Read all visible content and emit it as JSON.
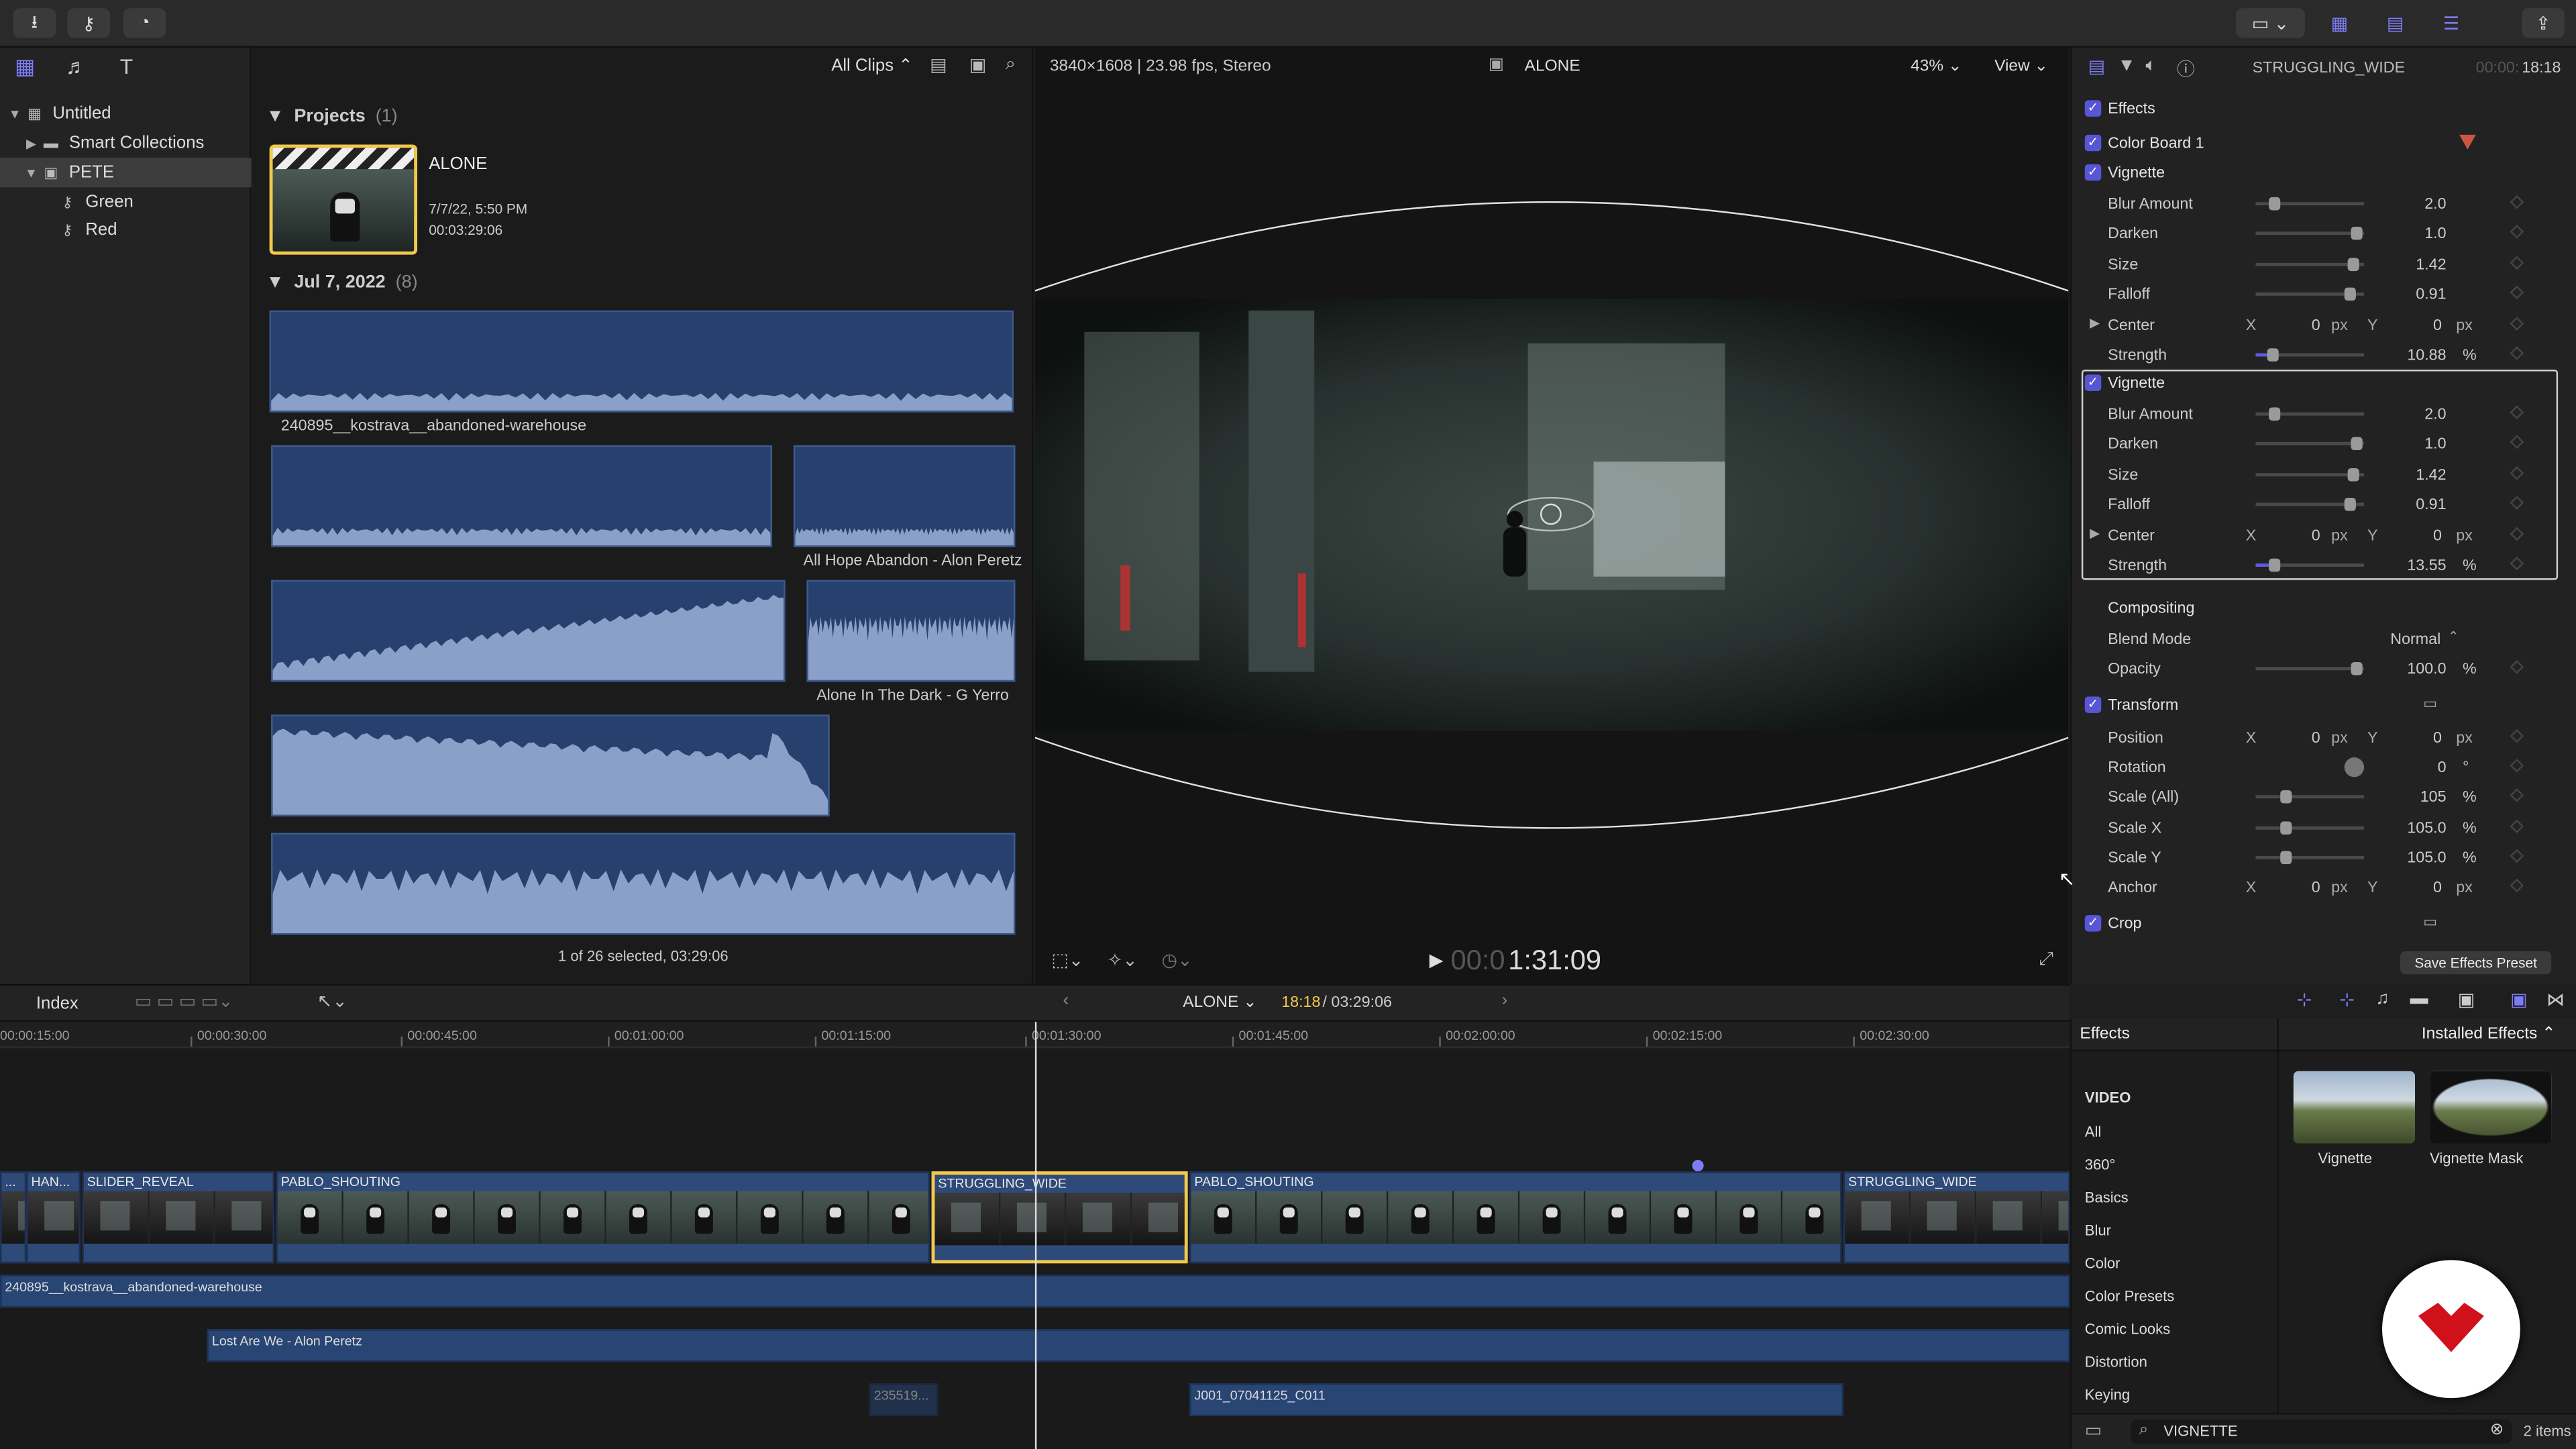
{
  "toolbar": {
    "icons": [
      "import-icon",
      "keyword-icon",
      "background-tasks-icon"
    ],
    "right_icons": [
      "workspace-icon",
      "layout-browser-icon",
      "layout-timeline-icon",
      "layout-inspector-icon",
      "share-icon"
    ]
  },
  "library": {
    "items": [
      {
        "label": "Untitled",
        "level": 0,
        "icon": "library-icon",
        "disclosure": "▼"
      },
      {
        "label": "Smart Collections",
        "level": 1,
        "icon": "folder-icon",
        "disclosure": "▶"
      },
      {
        "label": "PETE",
        "level": 1,
        "icon": "event-icon",
        "disclosure": "▼"
      },
      {
        "label": "Green",
        "level": 2,
        "icon": "keyword-icon",
        "disclosure": ""
      },
      {
        "label": "Red",
        "level": 2,
        "icon": "keyword-icon",
        "disclosure": ""
      }
    ]
  },
  "browser": {
    "filter": "All Clips",
    "status": "1 of 26 selected, 03:29:06",
    "projects_header": "Projects",
    "projects_count": "(1)",
    "project": {
      "name": "ALONE",
      "date": "7/7/22, 5:50 PM",
      "duration": "00:03:29:06"
    },
    "date_header": "Jul 7, 2022",
    "date_count": "(8)",
    "clips": [
      {
        "label": "240895__kostrava__abandoned-warehouse"
      },
      {
        "label": ""
      },
      {
        "label": "All Hope Abandon - Alon Peretz"
      },
      {
        "label": ""
      },
      {
        "label": "Alone In The Dark - G Yerro"
      },
      {
        "label": ""
      },
      {
        "label": ""
      }
    ]
  },
  "viewer": {
    "format": "3840×1608 | 23.98 fps, Stereo",
    "title": "ALONE",
    "zoom": "43%",
    "view_label": "View",
    "timecode_dim": "00:0",
    "timecode": "1:31:09"
  },
  "inspector": {
    "clip_name": "STRUGGLING_WIDE",
    "duration_dim": "00:00:",
    "duration": "18:18",
    "effects_label": "Effects",
    "color_board": "Color Board 1",
    "vignette1": {
      "title": "Vignette",
      "rows": [
        {
          "label": "Blur Amount",
          "value": "2.0",
          "pos": 0.17
        },
        {
          "label": "Darken",
          "value": "1.0",
          "pos": 0.93
        },
        {
          "label": "Size",
          "value": "1.42",
          "pos": 0.9
        },
        {
          "label": "Falloff",
          "value": "0.91",
          "pos": 0.86
        }
      ],
      "center": {
        "label": "Center",
        "x": "0",
        "y": "0",
        "unit": "px"
      },
      "strength": {
        "label": "Strength",
        "value": "10.88",
        "unit": "%",
        "pos": 0.15
      }
    },
    "vignette2": {
      "title": "Vignette",
      "rows": [
        {
          "label": "Blur Amount",
          "value": "2.0",
          "pos": 0.17
        },
        {
          "label": "Darken",
          "value": "1.0",
          "pos": 0.93
        },
        {
          "label": "Size",
          "value": "1.42",
          "pos": 0.9
        },
        {
          "label": "Falloff",
          "value": "0.91",
          "pos": 0.86
        }
      ],
      "center": {
        "label": "Center",
        "x": "0",
        "y": "0",
        "unit": "px"
      },
      "strength": {
        "label": "Strength",
        "value": "13.55",
        "unit": "%",
        "pos": 0.17
      }
    },
    "compositing": {
      "label": "Compositing",
      "blend_label": "Blend Mode",
      "blend_value": "Normal",
      "opacity_label": "Opacity",
      "opacity_value": "100.0",
      "opacity_unit": "%",
      "opacity_pos": 0.93
    },
    "transform": {
      "label": "Transform",
      "position_label": "Position",
      "pos_x": "0",
      "pos_y": "0",
      "rotation_label": "Rotation",
      "rotation_value": "0",
      "rotation_unit": "°",
      "scale_all_label": "Scale (All)",
      "scale_all": "105",
      "scale_x_label": "Scale X",
      "scale_x": "105.0",
      "scale_y_label": "Scale Y",
      "scale_y": "105.0",
      "anchor_label": "Anchor",
      "anchor_x": "0",
      "anchor_y": "0",
      "px": "px",
      "pct": "%",
      "x": "X",
      "y": "Y",
      "scale_pos": 0.27
    },
    "crop_label": "Crop",
    "save_preset": "Save Effects Preset"
  },
  "timeline": {
    "index_label": "Index",
    "project": "ALONE",
    "position": "18:18",
    "duration": "03:29:06",
    "ticks": [
      "00:00:15:00",
      "00:00:30:00",
      "00:00:45:00",
      "00:01:00:00",
      "00:01:15:00",
      "00:01:30:00",
      "00:01:45:00",
      "00:02:00:00",
      "00:02:15:00",
      "00:02:30:00"
    ],
    "clips": [
      {
        "name": "...",
        "dark": true
      },
      {
        "name": "HAN...",
        "dark": true
      },
      {
        "name": "SLIDER_REVEAL",
        "dark": true
      },
      {
        "name": "PABLO_SHOUTING",
        "dark": false
      },
      {
        "name": "STRUGGLING_WIDE",
        "dark": true
      },
      {
        "name": "PABLO_SHOUTING",
        "dark": false
      },
      {
        "name": "STRUGGLING_WIDE",
        "dark": true
      }
    ],
    "audio": [
      {
        "name": "240895__kostrava__abandoned-warehouse"
      },
      {
        "name": "Lost Are We - Alon Peretz"
      },
      {
        "name": "235519..."
      },
      {
        "name": "J001_07041125_C011"
      }
    ]
  },
  "effects_browser": {
    "title": "Effects",
    "installed": "Installed Effects",
    "section": "VIDEO",
    "categories": [
      "All",
      "360°",
      "Basics",
      "Blur",
      "Color",
      "Color Presets",
      "Comic Looks",
      "Distortion",
      "Keying"
    ],
    "items": [
      {
        "label": "Vignette"
      },
      {
        "label": "Vignette Mask"
      }
    ],
    "search": "VIGNETTE",
    "count": "2 items"
  },
  "colors": {
    "accent": "#5856d6",
    "selection": "#f2c94c",
    "clip": "#2e4a78"
  }
}
